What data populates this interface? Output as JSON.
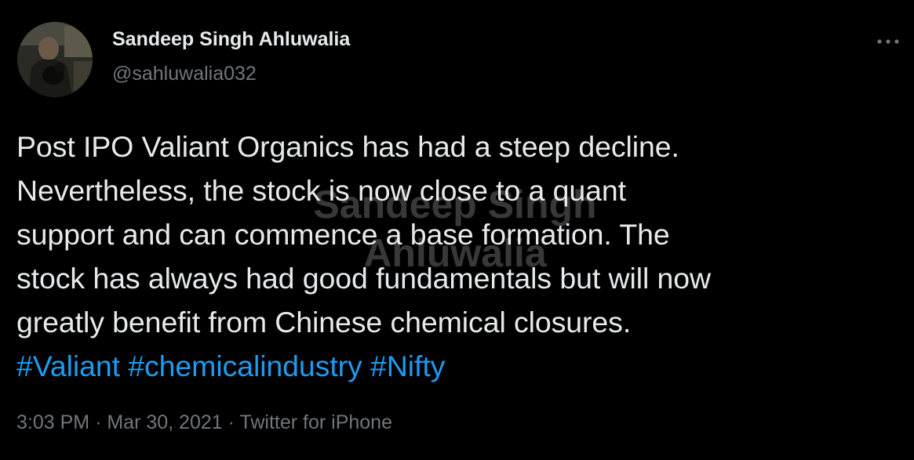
{
  "author": {
    "name": "Sandeep Singh Ahluwalia",
    "handle": "@sahluwalia032"
  },
  "tweet": {
    "lines": [
      "Post IPO Valiant Organics has had a steep decline.",
      "Nevertheless, the stock is now close to a quant",
      "support and can commence a base formation. The",
      "stock has always had good fundamentals but will now",
      "greatly benefit from Chinese chemical closures."
    ],
    "hashtags": [
      "#Valiant",
      "#chemicalindustry",
      "#Nifty"
    ]
  },
  "watermark": {
    "line1": "Sandeep Singh",
    "line2": "Ahluwalia"
  },
  "meta": {
    "time": "3:03 PM",
    "separator": "·",
    "date": "Mar 30, 2021",
    "source": "Twitter for iPhone"
  },
  "icons": {
    "more": "more-horizontal-icon"
  },
  "colors": {
    "background": "#000000",
    "text": "#e7e9ea",
    "secondary": "#71767b",
    "link": "#1d9bf0"
  }
}
